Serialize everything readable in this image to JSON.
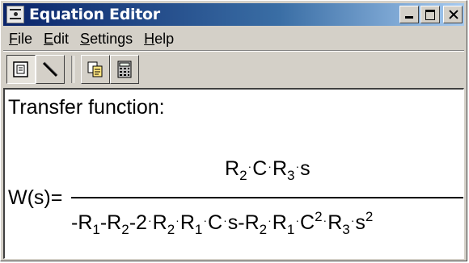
{
  "window": {
    "title": "Equation Editor",
    "icons": {
      "app": "equation-app-icon",
      "minimize": "minimize-icon",
      "maximize": "maximize-icon",
      "close": "close-icon"
    }
  },
  "menu": {
    "items": [
      {
        "key": "F",
        "rest": "ile"
      },
      {
        "key": "E",
        "rest": "dit"
      },
      {
        "key": "S",
        "rest": "ettings"
      },
      {
        "key": "H",
        "rest": "elp"
      }
    ]
  },
  "toolbar": {
    "buttons": [
      {
        "icon": "document-icon",
        "pressed": true
      },
      {
        "icon": "pen-icon",
        "pressed": false
      },
      {
        "icon": "copy-icon",
        "pressed": false
      },
      {
        "icon": "calculator-icon",
        "pressed": false
      }
    ]
  },
  "equation": {
    "heading": "Transfer function:",
    "lhs": "W(s)=",
    "numerator": {
      "R": "R",
      "sub2": "2",
      "C": "C",
      "R3": "R",
      "sub3": "3",
      "s": "s"
    },
    "denominator": {
      "t1": "-R",
      "t1sub": "1",
      "t2": "-R",
      "t2sub": "2",
      "t3": "-2",
      "t3R": "R",
      "t3Rsub": "2",
      "t3R1": "R",
      "t3R1sub": "1",
      "t3C": "C",
      "t3s": "s",
      "t4": "-R",
      "t4sub": "2",
      "t4R1": "R",
      "t4R1sub": "1",
      "t4C": "C",
      "t4Csup": "2",
      "t4R3": "R",
      "t4R3sub": "3",
      "t4s": "s",
      "t4ssup": "2"
    }
  },
  "colors": {
    "titlebar_start": "#0a246a",
    "titlebar_end": "#a6caf0",
    "chrome": "#d4d0c8"
  }
}
